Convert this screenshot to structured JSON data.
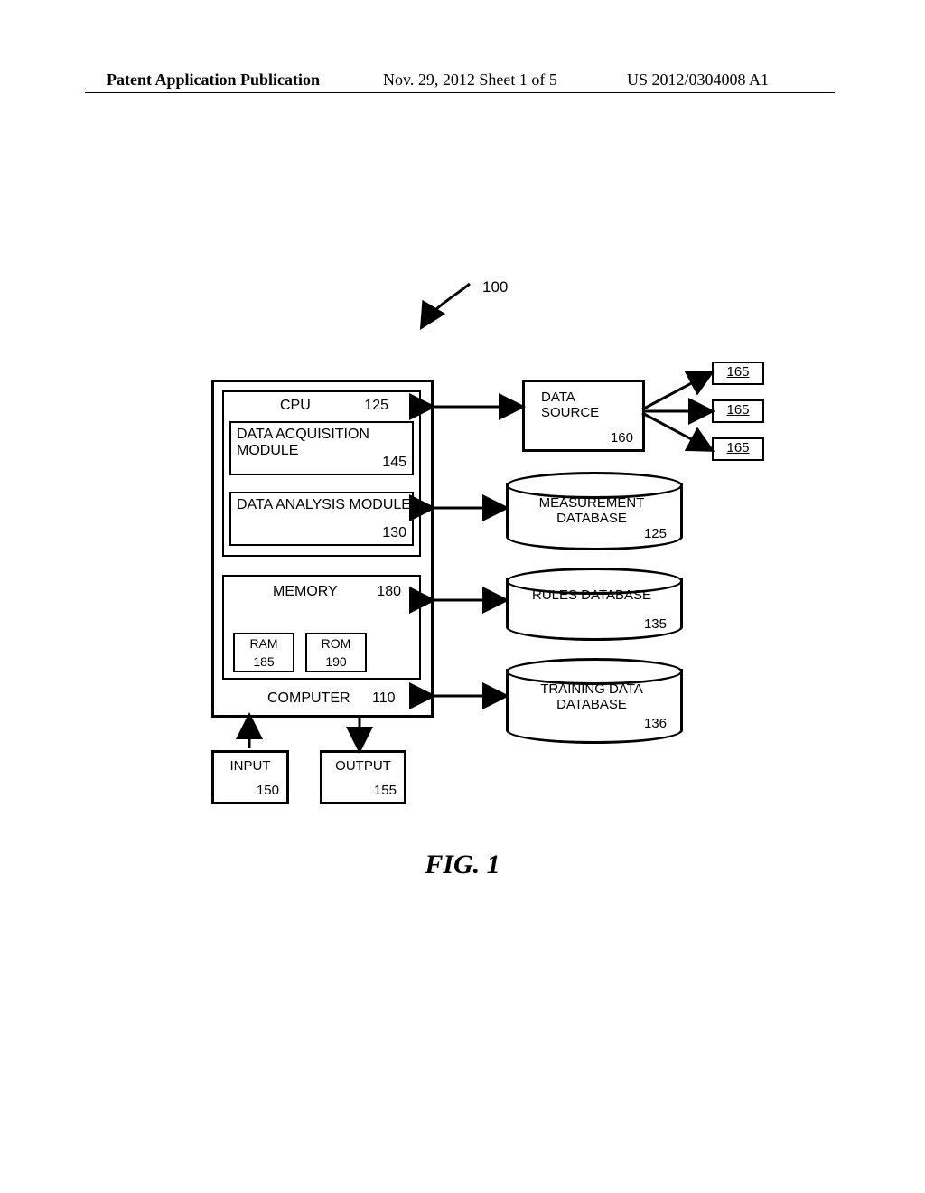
{
  "header": {
    "left": "Patent Application Publication",
    "mid": "Nov. 29, 2012  Sheet 1 of 5",
    "right": "US 2012/0304008 A1"
  },
  "system_ref": "100",
  "computer": {
    "label": "COMPUTER",
    "ref": "110",
    "cpu": {
      "label": "CPU",
      "ref": "125"
    },
    "data_acq": {
      "label": "DATA ACQUISITION MODULE",
      "ref": "145"
    },
    "data_ana": {
      "label": "DATA ANALYSIS MODULE",
      "ref": "130"
    },
    "memory": {
      "label": "MEMORY",
      "ref": "180",
      "ram": {
        "label": "RAM",
        "ref": "185"
      },
      "rom": {
        "label": "ROM",
        "ref": "190"
      }
    },
    "input": {
      "label": "INPUT",
      "ref": "150"
    },
    "output": {
      "label": "OUTPUT",
      "ref": "155"
    }
  },
  "data_source": {
    "label": "DATA SOURCE",
    "ref": "160"
  },
  "sources165": "165",
  "db_measure": {
    "label": "MEASUREMENT DATABASE",
    "ref": "125"
  },
  "db_rules": {
    "label": "RULES DATABASE",
    "ref": "135"
  },
  "db_training": {
    "label": "TRAINING DATA DATABASE",
    "ref": "136"
  },
  "figure_caption": "FIG.  1"
}
